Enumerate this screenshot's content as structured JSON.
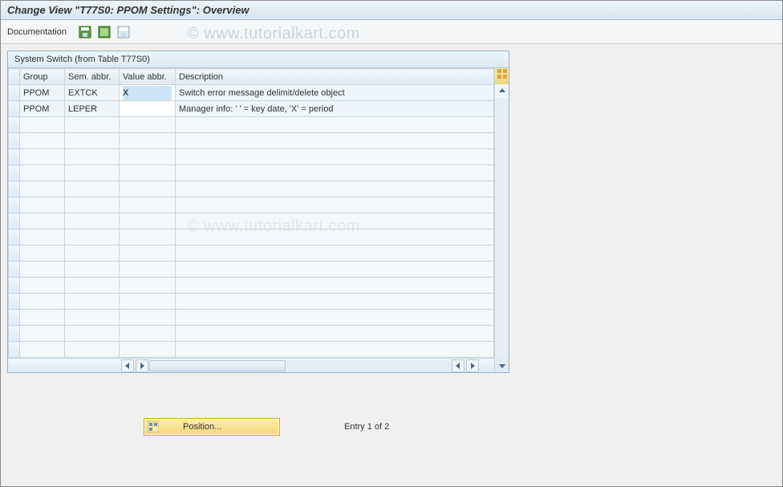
{
  "window": {
    "title": "Change View \"T77S0: PPOM Settings\": Overview"
  },
  "toolbar": {
    "documentation": "Documentation"
  },
  "watermark": "© www.tutorialkart.com",
  "panel": {
    "title": "System Switch (from Table T77S0)"
  },
  "columns": {
    "group": "Group",
    "sem": "Sem. abbr.",
    "val": "Value abbr.",
    "desc": "Description"
  },
  "rows": [
    {
      "group": "PPOM",
      "sem": "EXTCK",
      "val": "X",
      "desc": "Switch error message delimit/delete object",
      "selected": true
    },
    {
      "group": "PPOM",
      "sem": "LEPER",
      "val": "",
      "desc": "Manager info: ' ' = key date, 'X' = period",
      "selected": false
    }
  ],
  "footer": {
    "position": "Position...",
    "entry": "Entry 1 of 2"
  }
}
